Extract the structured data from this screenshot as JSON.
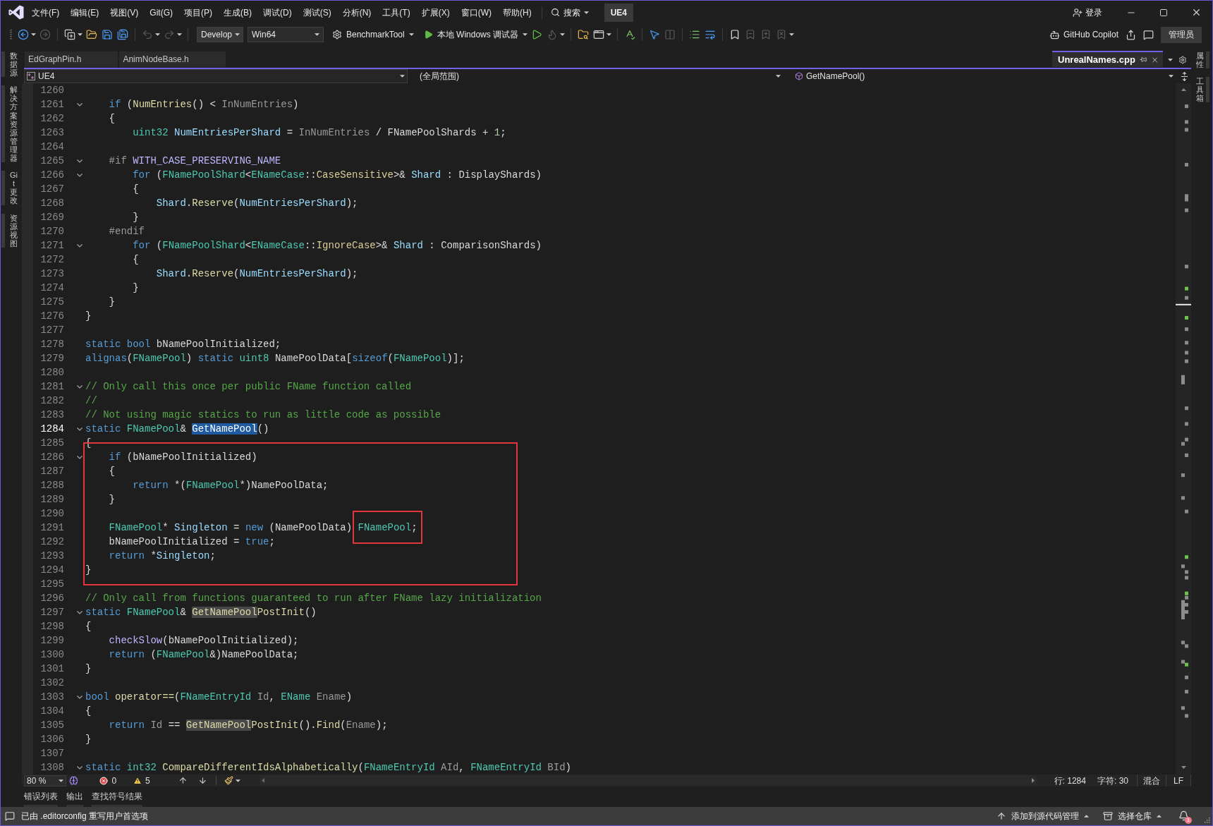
{
  "menu_bar": {
    "items": [
      "文件(F)",
      "编辑(E)",
      "视图(V)",
      "Git(G)",
      "项目(P)",
      "生成(B)",
      "调试(D)",
      "测试(S)",
      "分析(N)",
      "工具(T)",
      "扩展(X)",
      "窗口(W)",
      "帮助(H)"
    ],
    "search": "搜索",
    "solution": "UE4",
    "sign_in": "登录"
  },
  "toolbar": {
    "groups": [
      [
        {
          "kind": "icon",
          "disabled": false,
          "caret": true
        },
        {
          "kind": "icon",
          "disabled": true
        }
      ],
      [
        {
          "kind": "icon",
          "disabled": false,
          "caret": true
        },
        {
          "kind": "icon",
          "disabled": false
        },
        {
          "kind": "icon",
          "disabled": false
        },
        {
          "kind": "icon",
          "disabled": false
        }
      ],
      [
        {
          "kind": "icon",
          "disabled": true,
          "caret": true
        },
        {
          "kind": "icon",
          "disabled": true,
          "caret": true
        }
      ],
      [
        {
          "kind": "combo",
          "label": "Develop"
        },
        {
          "kind": "combo",
          "label": "Win64"
        },
        {
          "kind": "command",
          "label": "BenchmarkTool",
          "caret": true
        },
        {
          "kind": "command",
          "label": "本地 Windows 调试器",
          "caret": true
        },
        {
          "kind": "icon",
          "disabled": false
        },
        {
          "kind": "icon",
          "disabled": true,
          "caret": true
        }
      ],
      [
        {
          "kind": "icon",
          "disabled": false
        },
        {
          "kind": "icon",
          "disabled": false,
          "caret": true
        }
      ],
      [
        {
          "kind": "icon",
          "disabled": false
        }
      ],
      [
        {
          "kind": "icon",
          "disabled": false
        },
        {
          "kind": "icon",
          "disabled": true
        }
      ],
      [
        {
          "kind": "icon",
          "disabled": false
        },
        {
          "kind": "icon",
          "disabled": false
        }
      ],
      [
        {
          "kind": "icon",
          "disabled": false
        },
        {
          "kind": "icon",
          "disabled": true
        },
        {
          "kind": "icon",
          "disabled": true
        },
        {
          "kind": "icon",
          "disabled": true,
          "caret": true
        }
      ]
    ],
    "copilot": "GitHub Copilot",
    "role": "管理员"
  },
  "left_side_tabs": [
    "数据源",
    "解决方案资源管理器",
    "Git 更改",
    "资源视图"
  ],
  "right_side_tabs": [
    "属性",
    "工具箱"
  ],
  "document_tabs": [
    {
      "label": "EdGraphPin.h",
      "selected": false
    },
    {
      "label": "AnimNodeBase.h",
      "selected": false
    },
    {
      "label": "UnrealNames.cpp",
      "selected": true
    }
  ],
  "navigation_bar": {
    "project": "UE4",
    "scope": "(全局范围)",
    "member": "GetNamePool()"
  },
  "code": {
    "lines": [
      {
        "kind": "line",
        "number": "1260",
        "fold": false,
        "current": false
      },
      {
        "kind": "line",
        "number": "1261",
        "fold": true,
        "current": false,
        "tokens": [
          {
            "text": "    if",
            "kind": "keyword"
          },
          {
            "text": " (",
            "kind": "plain"
          },
          {
            "text": "NumEntries",
            "kind": "function"
          },
          {
            "text": "() < ",
            "kind": "plain"
          },
          {
            "text": "InNumEntries",
            "kind": "parameter"
          },
          {
            "text": ")",
            "kind": "plain"
          }
        ]
      },
      {
        "kind": "line",
        "number": "1262",
        "fold": false,
        "current": false,
        "tokens": [
          {
            "text": "    {",
            "kind": "plain"
          }
        ]
      },
      {
        "kind": "line",
        "number": "1263",
        "fold": false,
        "current": false,
        "tokens": [
          {
            "text": "        uint32 ",
            "kind": "type"
          },
          {
            "text": "NumEntriesPerShard",
            "kind": "variable"
          },
          {
            "text": " = ",
            "kind": "plain"
          },
          {
            "text": "InNumEntries",
            "kind": "parameter"
          },
          {
            "text": " / ",
            "kind": "plain"
          },
          {
            "text": "FNamePoolShards",
            "kind": "global"
          },
          {
            "text": " + ",
            "kind": "plain"
          },
          {
            "text": "1",
            "kind": "number"
          },
          {
            "text": ";",
            "kind": "plain"
          }
        ]
      },
      {
        "kind": "line",
        "number": "1264",
        "fold": false,
        "current": false
      },
      {
        "kind": "line",
        "number": "1265",
        "fold": true,
        "current": false,
        "tokens": [
          {
            "text": "    #if ",
            "kind": "preprocessor"
          },
          {
            "text": "WITH_CASE_PRESERVING_NAME",
            "kind": "macro"
          }
        ]
      },
      {
        "kind": "line",
        "number": "1266",
        "fold": true,
        "current": false,
        "tokens": [
          {
            "text": "        for",
            "kind": "keyword"
          },
          {
            "text": " (",
            "kind": "plain"
          },
          {
            "text": "FNamePoolShard",
            "kind": "type"
          },
          {
            "text": "<",
            "kind": "plain"
          },
          {
            "text": "ENameCase",
            "kind": "type"
          },
          {
            "text": "::",
            "kind": "plain"
          },
          {
            "text": "CaseSensitive",
            "kind": "enum"
          },
          {
            "text": ">& ",
            "kind": "plain"
          },
          {
            "text": "Shard",
            "kind": "variable"
          },
          {
            "text": " : ",
            "kind": "plain"
          },
          {
            "text": "DisplayShards",
            "kind": "global"
          },
          {
            "text": ")",
            "kind": "plain"
          }
        ]
      },
      {
        "kind": "line",
        "number": "1267",
        "fold": false,
        "current": false,
        "tokens": [
          {
            "text": "        {",
            "kind": "plain"
          }
        ]
      },
      {
        "kind": "line",
        "number": "1268",
        "fold": false,
        "current": false,
        "tokens": [
          {
            "text": "            Shard",
            "kind": "variable"
          },
          {
            "text": ".",
            "kind": "plain"
          },
          {
            "text": "Reserve",
            "kind": "function"
          },
          {
            "text": "(",
            "kind": "plain"
          },
          {
            "text": "NumEntriesPerShard",
            "kind": "variable"
          },
          {
            "text": ");",
            "kind": "plain"
          }
        ]
      },
      {
        "kind": "line",
        "number": "1269",
        "fold": false,
        "current": false,
        "tokens": [
          {
            "text": "        }",
            "kind": "plain"
          }
        ]
      },
      {
        "kind": "line",
        "number": "1270",
        "fold": false,
        "current": false,
        "tokens": [
          {
            "text": "    #endif",
            "kind": "preprocessor"
          }
        ]
      },
      {
        "kind": "line",
        "number": "1271",
        "fold": true,
        "current": false,
        "tokens": [
          {
            "text": "        for",
            "kind": "keyword"
          },
          {
            "text": " (",
            "kind": "plain"
          },
          {
            "text": "FNamePoolShard",
            "kind": "type"
          },
          {
            "text": "<",
            "kind": "plain"
          },
          {
            "text": "ENameCase",
            "kind": "type"
          },
          {
            "text": "::",
            "kind": "plain"
          },
          {
            "text": "IgnoreCase",
            "kind": "enum"
          },
          {
            "text": ">& ",
            "kind": "plain"
          },
          {
            "text": "Shard",
            "kind": "variable"
          },
          {
            "text": " : ",
            "kind": "plain"
          },
          {
            "text": "ComparisonShards",
            "kind": "global"
          },
          {
            "text": ")",
            "kind": "plain"
          }
        ]
      },
      {
        "kind": "line",
        "number": "1272",
        "fold": false,
        "current": false,
        "tokens": [
          {
            "text": "        {",
            "kind": "plain"
          }
        ]
      },
      {
        "kind": "line",
        "number": "1273",
        "fold": false,
        "current": false,
        "tokens": [
          {
            "text": "            Shard",
            "kind": "variable"
          },
          {
            "text": ".",
            "kind": "plain"
          },
          {
            "text": "Reserve",
            "kind": "function"
          },
          {
            "text": "(",
            "kind": "plain"
          },
          {
            "text": "NumEntriesPerShard",
            "kind": "variable"
          },
          {
            "text": ");",
            "kind": "plain"
          }
        ]
      },
      {
        "kind": "line",
        "number": "1274",
        "fold": false,
        "current": false,
        "tokens": [
          {
            "text": "        }",
            "kind": "plain"
          }
        ]
      },
      {
        "kind": "line",
        "number": "1275",
        "fold": false,
        "current": false,
        "tokens": [
          {
            "text": "    }",
            "kind": "plain"
          }
        ]
      },
      {
        "kind": "line",
        "number": "1276",
        "fold": false,
        "current": false,
        "tokens": [
          {
            "text": "}",
            "kind": "plain"
          }
        ]
      },
      {
        "kind": "line",
        "number": "1277",
        "fold": false,
        "current": false
      },
      {
        "kind": "line",
        "number": "1278",
        "fold": false,
        "current": false,
        "tokens": [
          {
            "text": "static bool ",
            "kind": "keyword"
          },
          {
            "text": "bNamePoolInitialized",
            "kind": "global"
          },
          {
            "text": ";",
            "kind": "plain"
          }
        ]
      },
      {
        "kind": "line",
        "number": "1279",
        "fold": false,
        "current": false,
        "tokens": [
          {
            "text": "alignas",
            "kind": "keyword"
          },
          {
            "text": "(",
            "kind": "plain"
          },
          {
            "text": "FNamePool",
            "kind": "type"
          },
          {
            "text": ") ",
            "kind": "plain"
          },
          {
            "text": "static ",
            "kind": "keyword"
          },
          {
            "text": "uint8 ",
            "kind": "type"
          },
          {
            "text": "NamePoolData",
            "kind": "global"
          },
          {
            "text": "[",
            "kind": "plain"
          },
          {
            "text": "sizeof",
            "kind": "keyword"
          },
          {
            "text": "(",
            "kind": "plain"
          },
          {
            "text": "FNamePool",
            "kind": "type"
          },
          {
            "text": ")];",
            "kind": "plain"
          }
        ]
      },
      {
        "kind": "line",
        "number": "1280",
        "fold": false,
        "current": false
      },
      {
        "kind": "line",
        "number": "1281",
        "fold": true,
        "current": false,
        "tokens": [
          {
            "text": "// Only call this once per public FName function called",
            "kind": "comment"
          }
        ]
      },
      {
        "kind": "line",
        "number": "1282",
        "fold": false,
        "current": false,
        "tokens": [
          {
            "text": "//",
            "kind": "comment"
          }
        ]
      },
      {
        "kind": "line",
        "number": "1283",
        "fold": false,
        "current": false,
        "tokens": [
          {
            "text": "// Not using magic statics to run as little code as possible",
            "kind": "comment"
          }
        ]
      },
      {
        "kind": "line",
        "number": "1284",
        "fold": true,
        "current": true,
        "tokens": [
          {
            "text": "static ",
            "kind": "keyword"
          },
          {
            "text": "FNamePool",
            "kind": "type"
          },
          {
            "text": "& ",
            "kind": "plain"
          },
          {
            "text": "GetNamePool",
            "kind": "function",
            "selected": true
          },
          {
            "text": "()",
            "kind": "plain"
          }
        ]
      },
      {
        "kind": "frame",
        "lines": [
          {
            "number": "1285",
            "fold": false,
            "current": false,
            "tokens": [
              {
                "text": "{",
                "kind": "plain"
              }
            ]
          },
          {
            "number": "1286",
            "fold": true,
            "current": false,
            "tokens": [
              {
                "text": "    if",
                "kind": "keyword"
              },
              {
                "text": " (",
                "kind": "plain"
              },
              {
                "text": "bNamePoolInitialized",
                "kind": "global"
              },
              {
                "text": ")",
                "kind": "plain"
              }
            ]
          },
          {
            "number": "1287",
            "fold": false,
            "current": false,
            "tokens": [
              {
                "text": "    {",
                "kind": "plain"
              }
            ]
          },
          {
            "number": "1288",
            "fold": false,
            "current": false,
            "tokens": [
              {
                "text": "        return",
                "kind": "keyword"
              },
              {
                "text": " *(",
                "kind": "plain"
              },
              {
                "text": "FNamePool",
                "kind": "type"
              },
              {
                "text": "*)",
                "kind": "plain"
              },
              {
                "text": "NamePoolData",
                "kind": "global"
              },
              {
                "text": ";",
                "kind": "plain"
              }
            ]
          },
          {
            "number": "1289",
            "fold": false,
            "current": false,
            "tokens": [
              {
                "text": "    }",
                "kind": "plain"
              }
            ]
          },
          {
            "number": "1290",
            "fold": false,
            "current": false
          },
          {
            "number": "1291",
            "fold": false,
            "current": false,
            "tokens": [
              {
                "text": "    FNamePool",
                "kind": "type"
              },
              {
                "text": "* ",
                "kind": "plain"
              },
              {
                "text": "Singleton",
                "kind": "variable"
              },
              {
                "text": " = ",
                "kind": "plain"
              },
              {
                "text": "new",
                "kind": "keyword"
              },
              {
                "text": " (",
                "kind": "plain"
              },
              {
                "text": "NamePoolData",
                "kind": "global"
              },
              {
                "text": ") ",
                "kind": "plain"
              },
              {
                "text": "FNamePool",
                "kind": "type",
                "framed": true
              },
              {
                "text": ";",
                "kind": "plain",
                "framed": true
              }
            ]
          },
          {
            "number": "1292",
            "fold": false,
            "current": false,
            "tokens": [
              {
                "text": "    bNamePoolInitialized",
                "kind": "global"
              },
              {
                "text": " = ",
                "kind": "plain"
              },
              {
                "text": "true",
                "kind": "keyword"
              },
              {
                "text": ";",
                "kind": "plain"
              }
            ]
          },
          {
            "number": "1293",
            "fold": false,
            "current": false,
            "tokens": [
              {
                "text": "    return",
                "kind": "keyword"
              },
              {
                "text": " *",
                "kind": "plain"
              },
              {
                "text": "Singleton",
                "kind": "variable"
              },
              {
                "text": ";",
                "kind": "plain"
              }
            ]
          },
          {
            "number": "1294",
            "fold": false,
            "current": false,
            "tokens": [
              {
                "text": "}",
                "kind": "plain"
              }
            ]
          },
          {
            "number": "1295",
            "fold": false,
            "current": false
          }
        ]
      },
      {
        "kind": "line",
        "number": "1296",
        "fold": false,
        "current": false,
        "tokens": [
          {
            "text": "// Only call from functions guaranteed to run after FName lazy initialization",
            "kind": "comment"
          }
        ]
      },
      {
        "kind": "line",
        "number": "1297",
        "fold": true,
        "current": false,
        "tokens": [
          {
            "text": "static ",
            "kind": "keyword"
          },
          {
            "text": "FNamePool",
            "kind": "type"
          },
          {
            "text": "& ",
            "kind": "plain"
          },
          {
            "text": "GetNamePool",
            "kind": "function",
            "highlighted": true
          },
          {
            "text": "PostInit",
            "kind": "function"
          },
          {
            "text": "()",
            "kind": "plain"
          }
        ]
      },
      {
        "kind": "line",
        "number": "1298",
        "fold": false,
        "current": false,
        "tokens": [
          {
            "text": "{",
            "kind": "plain"
          }
        ]
      },
      {
        "kind": "line",
        "number": "1299",
        "fold": false,
        "current": false,
        "tokens": [
          {
            "text": "    checkSlow",
            "kind": "macro"
          },
          {
            "text": "(",
            "kind": "plain"
          },
          {
            "text": "bNamePoolInitialized",
            "kind": "global"
          },
          {
            "text": ");",
            "kind": "plain"
          }
        ]
      },
      {
        "kind": "line",
        "number": "1300",
        "fold": false,
        "current": false,
        "tokens": [
          {
            "text": "    return",
            "kind": "keyword"
          },
          {
            "text": " (",
            "kind": "plain"
          },
          {
            "text": "FNamePool",
            "kind": "type"
          },
          {
            "text": "&)",
            "kind": "plain"
          },
          {
            "text": "NamePoolData",
            "kind": "global"
          },
          {
            "text": ";",
            "kind": "plain"
          }
        ]
      },
      {
        "kind": "line",
        "number": "1301",
        "fold": false,
        "current": false,
        "tokens": [
          {
            "text": "}",
            "kind": "plain"
          }
        ]
      },
      {
        "kind": "line",
        "number": "1302",
        "fold": false,
        "current": false
      },
      {
        "kind": "line",
        "number": "1303",
        "fold": true,
        "current": false,
        "tokens": [
          {
            "text": "bool ",
            "kind": "keyword"
          },
          {
            "text": "operator==",
            "kind": "function"
          },
          {
            "text": "(",
            "kind": "plain"
          },
          {
            "text": "FNameEntryId ",
            "kind": "type"
          },
          {
            "text": "Id",
            "kind": "parameter"
          },
          {
            "text": ", ",
            "kind": "plain"
          },
          {
            "text": "EName ",
            "kind": "type"
          },
          {
            "text": "Ename",
            "kind": "parameter"
          },
          {
            "text": ")",
            "kind": "plain"
          }
        ]
      },
      {
        "kind": "line",
        "number": "1304",
        "fold": false,
        "current": false,
        "tokens": [
          {
            "text": "{",
            "kind": "plain"
          }
        ]
      },
      {
        "kind": "line",
        "number": "1305",
        "fold": false,
        "current": false,
        "tokens": [
          {
            "text": "    return ",
            "kind": "keyword"
          },
          {
            "text": "Id",
            "kind": "parameter"
          },
          {
            "text": " == ",
            "kind": "plain"
          },
          {
            "text": "GetNamePool",
            "kind": "function",
            "highlighted": true
          },
          {
            "text": "PostInit",
            "kind": "function"
          },
          {
            "text": "().",
            "kind": "plain"
          },
          {
            "text": "Find",
            "kind": "function"
          },
          {
            "text": "(",
            "kind": "plain"
          },
          {
            "text": "Ename",
            "kind": "parameter"
          },
          {
            "text": ");",
            "kind": "plain"
          }
        ]
      },
      {
        "kind": "line",
        "number": "1306",
        "fold": false,
        "current": false,
        "tokens": [
          {
            "text": "}",
            "kind": "plain"
          }
        ]
      },
      {
        "kind": "line",
        "number": "1307",
        "fold": false,
        "current": false
      },
      {
        "kind": "line",
        "number": "1308",
        "fold": true,
        "current": false,
        "tokens": [
          {
            "text": "static ",
            "kind": "keyword"
          },
          {
            "text": "int32 ",
            "kind": "type"
          },
          {
            "text": "CompareDifferentIdsAlphabetically",
            "kind": "function"
          },
          {
            "text": "(",
            "kind": "plain"
          },
          {
            "text": "FNameEntryId ",
            "kind": "type"
          },
          {
            "text": "AId",
            "kind": "parameter"
          },
          {
            "text": ", ",
            "kind": "plain"
          },
          {
            "text": "FNameEntryId ",
            "kind": "type"
          },
          {
            "text": "BId",
            "kind": "parameter"
          },
          {
            "text": ")",
            "kind": "plain"
          }
        ]
      }
    ]
  },
  "editor_status": {
    "zoom": "80 %",
    "errors": "0",
    "warnings": "5",
    "line": "行: 1284",
    "column": "字符: 30",
    "indentation": "混合",
    "line_ending": "LF"
  },
  "tool_tabs": [
    "错误列表",
    "输出",
    "查找符号结果"
  ],
  "status_bar": {
    "message": "已由 .editorconfig 重写用户首选项",
    "source_control": "添加到源代码管理",
    "repository": "选择仓库",
    "notifications": "1"
  }
}
